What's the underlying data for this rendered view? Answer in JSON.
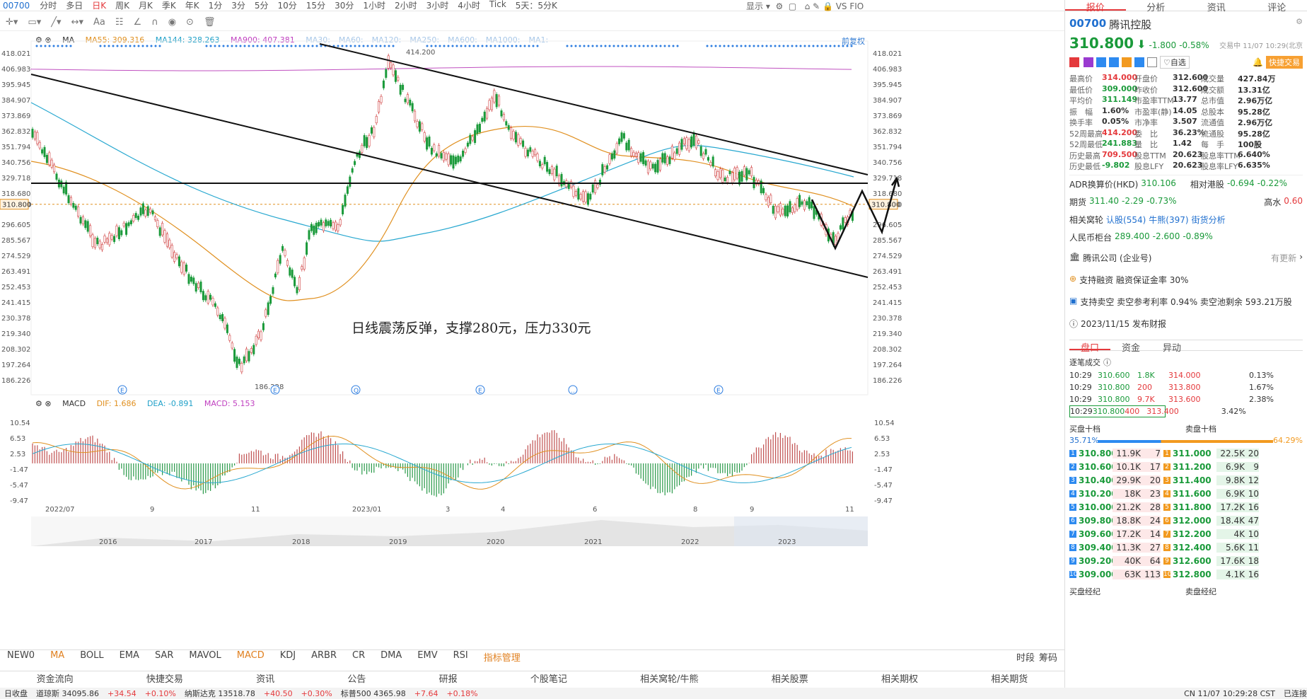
{
  "toolbar": {
    "code": "00700",
    "periods": [
      "分时",
      "多日",
      "日K",
      "周K",
      "月K",
      "季K",
      "年K",
      "1分",
      "3分",
      "5分",
      "10分",
      "15分",
      "30分",
      "1小时",
      "2小时",
      "3小时",
      "4小时",
      "Tick",
      "5天：5分K"
    ],
    "active": "日K",
    "display_label": "显示",
    "compare_label": "VS FIO"
  },
  "ma": {
    "type": "MA",
    "ma55": "MA55: 309.316",
    "ma144": "MA144: 328.263",
    "ma900": "MA900: 407.381",
    "others": [
      "MA30:",
      "MA60:",
      "MA120:",
      "MA250:",
      "MA600:",
      "MA1000:",
      "MA1:"
    ],
    "adjust": "前复权"
  },
  "macd": {
    "title": "MACD",
    "dif": "DIF: 1.686",
    "dea": "DEA: -0.891",
    "macd": "MACD: 5.153"
  },
  "annotation": "日线震荡反弹，支撑280元，压力330元",
  "chart_data": {
    "type": "candlestick",
    "y_ticks": [
      418.021,
      406.983,
      395.945,
      384.907,
      373.869,
      362.832,
      351.794,
      340.756,
      329.718,
      318.68,
      310.8,
      296.605,
      285.567,
      274.529,
      263.491,
      252.453,
      241.415,
      230.378,
      219.34,
      208.302,
      197.264,
      186.226
    ],
    "price_high_label": "414.200",
    "price_low_label": "186.228",
    "current_price": "310.800",
    "macd_ticks": [
      10.54,
      6.53,
      2.53,
      -1.47,
      -5.47,
      -9.47
    ],
    "x_labels": [
      "2022/07",
      "9",
      "11",
      "2023/01",
      "3",
      "4",
      "6",
      "8",
      "9",
      "11"
    ],
    "overview_years": [
      "2016",
      "2017",
      "2018",
      "2019",
      "2020",
      "2021",
      "2022",
      "2023"
    ]
  },
  "indicators": [
    "NEW0",
    "MA",
    "BOLL",
    "EMA",
    "SAR",
    "MAVOL",
    "MACD",
    "KDJ",
    "ARBR",
    "CR",
    "DMA",
    "EMV",
    "RSI",
    "指标管理"
  ],
  "indicator_right": [
    "时段",
    "筹码"
  ],
  "bottom_tabs": [
    "资金流向",
    "快捷交易",
    "资讯",
    "公告",
    "研报",
    "个股笔记",
    "相关窝轮/牛熊",
    "相关股票",
    "相关期权",
    "相关期货"
  ],
  "panel": {
    "tabs": [
      "报价",
      "分析",
      "资讯",
      "评论"
    ],
    "code": "00700",
    "name": "腾讯控股",
    "price": "310.800",
    "change": "-1.800",
    "pct": "-0.58%",
    "status": "交易中 11/07 10:29(北京",
    "buttons": [
      "自选",
      "快捷交易"
    ],
    "stats": [
      [
        "最高价",
        "314.000",
        "开盘价",
        "312.600",
        "成交量",
        "427.84万"
      ],
      [
        "最低价",
        "309.000",
        "昨收价",
        "312.600",
        "成交额",
        "13.31亿"
      ],
      [
        "平均价",
        "311.149",
        "市盈率TTM",
        "13.77",
        "总市值",
        "2.96万亿"
      ],
      [
        "振　幅",
        "1.60%",
        "市盈率(静)",
        "14.05",
        "总股本",
        "95.28亿"
      ],
      [
        "换手率",
        "0.05%",
        "市净率",
        "3.507",
        "流通值",
        "2.96万亿"
      ],
      [
        "52周最高",
        "414.200",
        "委　比",
        "36.23%",
        "流通股",
        "95.28亿"
      ],
      [
        "52周最低",
        "241.883",
        "量　比",
        "1.42",
        "每　手",
        "100股"
      ],
      [
        "历史最高",
        "709.500",
        "股息TTM",
        "20.623",
        "股息率TTM",
        "6.640%"
      ],
      [
        "历史最低",
        "-9.802",
        "股息LFY",
        "20.623",
        "股息率LFY",
        "6.635%"
      ]
    ],
    "adr": [
      "ADR换算价(HKD)",
      "310.106",
      "相对港股",
      "-0.694",
      "-0.22%"
    ],
    "futures": [
      "期货",
      "311.40",
      "-2.29",
      "-0.73%",
      "高水",
      "0.60"
    ],
    "warrants": [
      "相关窝轮",
      "认股(554)",
      "牛熊(397)",
      "街货分析"
    ],
    "rmb": [
      "人民币柜台",
      "289.400",
      "-2.600",
      "-0.89%"
    ],
    "company": [
      "腾讯公司 (企业号)",
      "有更新"
    ],
    "margin": "支持融资  融资保证金率 30%",
    "short": "支持卖空  卖空参考利率 0.94%  卖空池剩余 593.21万股",
    "report": "2023/11/15  发布财报",
    "subtabs": [
      "盘口",
      "资金",
      "异动"
    ],
    "ticks_title": "逐笔成交",
    "ticks": [
      [
        "10:29",
        "310.600",
        "1.8K"
      ],
      [
        "10:29",
        "310.800",
        "200"
      ],
      [
        "10:29",
        "310.800",
        "9.7K"
      ],
      [
        "10:29",
        "310.800",
        "400"
      ]
    ],
    "dist": [
      [
        "314.000",
        "0.13%"
      ],
      [
        "313.800",
        "1.67%"
      ],
      [
        "313.600",
        "2.38%"
      ],
      [
        "313.400",
        "3.42%"
      ]
    ],
    "book_titles": [
      "买盘十档",
      "卖盘十档"
    ],
    "book_pct": [
      "35.71%",
      "64.29%"
    ],
    "bids": [
      [
        "310.800",
        "11.9K",
        "7"
      ],
      [
        "310.600",
        "10.1K",
        "17"
      ],
      [
        "310.400",
        "29.9K",
        "20"
      ],
      [
        "310.200",
        "18K",
        "23"
      ],
      [
        "310.000",
        "21.2K",
        "28"
      ],
      [
        "309.800",
        "18.8K",
        "24"
      ],
      [
        "309.600",
        "17.2K",
        "14"
      ],
      [
        "309.400",
        "11.3K",
        "27"
      ],
      [
        "309.200",
        "40K",
        "64"
      ],
      [
        "309.000",
        "63K",
        "113"
      ]
    ],
    "asks": [
      [
        "311.000",
        "22.5K",
        "20"
      ],
      [
        "311.200",
        "6.9K",
        "9"
      ],
      [
        "311.400",
        "9.8K",
        "12"
      ],
      [
        "311.600",
        "6.9K",
        "10"
      ],
      [
        "311.800",
        "17.2K",
        "16"
      ],
      [
        "312.000",
        "18.4K",
        "47"
      ],
      [
        "312.200",
        "4K",
        "10"
      ],
      [
        "312.400",
        "5.6K",
        "11"
      ],
      [
        "312.600",
        "17.6K",
        "18"
      ],
      [
        "312.800",
        "4.1K",
        "16"
      ]
    ],
    "brokers": [
      "买盘经纪",
      "卖盘经纪"
    ]
  },
  "status": [
    "日收盘",
    "道琼斯 34095.86",
    "+34.54",
    "+0.10%",
    "纳斯达克 13518.78",
    "+40.50",
    "+0.30%",
    "标普500 4365.98",
    "+7.64",
    "+0.18%",
    "CN 11/07 10:29:28 CST",
    "已连接"
  ]
}
